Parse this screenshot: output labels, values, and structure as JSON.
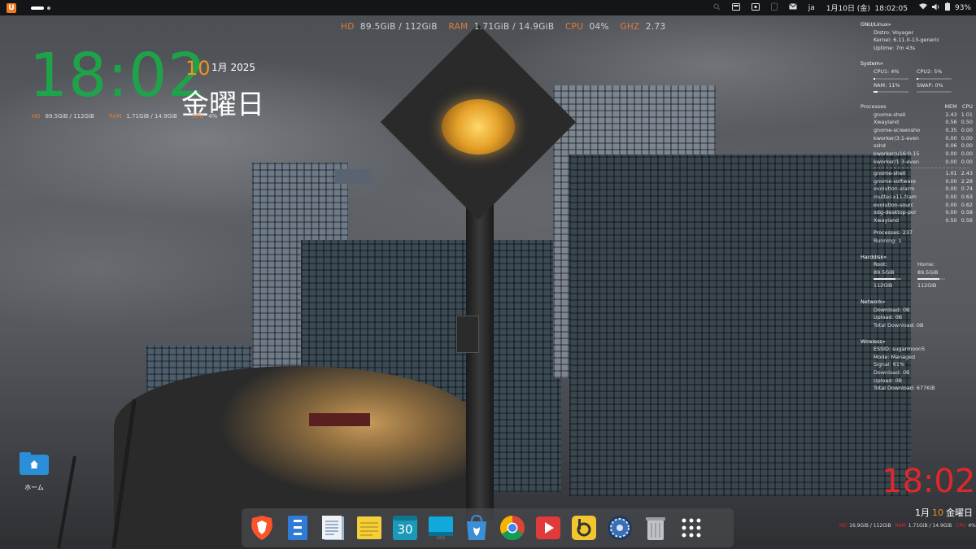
{
  "colors": {
    "clock_green": "#1fa34a",
    "accent_orange": "#e07b39",
    "date_orange": "#f0921e",
    "clock_red": "#e0272c",
    "topbar_bg": "#141518"
  },
  "topbar": {
    "logo_icon": "ubuntu-unity-logo-icon",
    "input_method": "ja",
    "datetime": "1月10日 (金)  18:02:05",
    "battery_percent": "93%",
    "tray_icons": [
      "search-icon",
      "weather-icon",
      "screenshot-icon",
      "clipboard-icon",
      "mail-icon",
      "wifi-icon",
      "volume-icon",
      "battery-icon"
    ]
  },
  "conky_top": {
    "hd_label": "HD",
    "hd_value": "89.5GiB / 112GiB",
    "ram_label": "RAM",
    "ram_value": "1.71GiB / 14.9GiB",
    "cpu_label": "CPU",
    "cpu_value": "04%",
    "ghz_label": "GHZ",
    "ghz_value": "2.73"
  },
  "clock": {
    "time": "18:02",
    "day": "10",
    "month_year": "1月 2025",
    "weekday": "金曜日",
    "stats": {
      "hd_label": "HD",
      "hd_value": "89.5GiB / 112GiB",
      "ram_label": "RAM",
      "ram_value": "1.71GiB / 14.9GiB",
      "cpu_label": "CPU",
      "cpu_value": "4%"
    }
  },
  "panel": {
    "gnu": {
      "title": "GNU/Linux»",
      "distro": "Distro: Voyager",
      "kernel": "Kernel: 6.11.0-13-generic",
      "uptime": "Uptime: 7m 43s"
    },
    "system": {
      "title": "System»",
      "cpu1_label": "CPU1: 4%",
      "cpu1_fill": 0.04,
      "cpu2_label": "CPU2: 5%",
      "cpu2_fill": 0.05,
      "ram_label": "RAM: 11%",
      "ram_fill": 0.11,
      "swap_label": "SWAP: 0%",
      "swap_fill": 0.0
    },
    "processes": {
      "title": "Processes",
      "mem_header": "MEM",
      "cpu_header": "CPU",
      "by_cpu": [
        {
          "name": "gnome-shell",
          "mem": "2.43",
          "cpu": "1.01"
        },
        {
          "name": "Xwayland",
          "mem": "0.56",
          "cpu": "0.50"
        },
        {
          "name": "gnome-screensho",
          "mem": "0.35",
          "cpu": "0.00"
        },
        {
          "name": "kworker/3:1-even",
          "mem": "0.00",
          "cpu": "0.00"
        },
        {
          "name": "sshd",
          "mem": "0.06",
          "cpu": "0.00"
        },
        {
          "name": "kworker/u16:0-15",
          "mem": "0.00",
          "cpu": "0.00"
        },
        {
          "name": "kworker/1:3-even",
          "mem": "0.00",
          "cpu": "0.00"
        }
      ],
      "by_mem": [
        {
          "name": "gnome-shell",
          "mem": "1.01",
          "cpu": "2.43"
        },
        {
          "name": "gnome-software",
          "mem": "0.00",
          "cpu": "2.28"
        },
        {
          "name": "evolution-alarm",
          "mem": "0.00",
          "cpu": "0.74"
        },
        {
          "name": "mutter-x11-fram",
          "mem": "0.00",
          "cpu": "0.63"
        },
        {
          "name": "evolution-sourc",
          "mem": "0.00",
          "cpu": "0.62"
        },
        {
          "name": "xdg-desktop-por",
          "mem": "0.00",
          "cpu": "0.58"
        },
        {
          "name": "Xwayland",
          "mem": "0.50",
          "cpu": "0.56"
        }
      ],
      "total": "Processes: 237",
      "running": "Running: 1"
    },
    "harddisk": {
      "title": "Harddisk»",
      "root_label": "Root: 89.5GiB",
      "root_fill": 0.8,
      "home_label": "Home: 89.5GiB",
      "home_fill": 0.8,
      "root_total": "112GiB",
      "home_total": "112GiB"
    },
    "network": {
      "title": "Network»",
      "download": "Download: 0B",
      "upload": "Upload: 0B",
      "total_download": "Total Download: 0B"
    },
    "wireless": {
      "title": "Wireless»",
      "essid": "ESSID: sugarmoon5",
      "mode": "Mode: Managed",
      "signal": "Signal: 61%",
      "download": "Download: 0B",
      "upload": "Upload: 0B",
      "total_download": "Total Download: 677KiB"
    }
  },
  "right_clock": {
    "time": "18:02",
    "month": "1月",
    "day": "10",
    "weekday": "金曜日",
    "stats": {
      "hd_label": "HD",
      "hd_value": "16.9GiB / 112GiB",
      "ram_label": "RAM",
      "ram_value": "1.71GiB / 14.9GiB",
      "cpu_label": "CPU",
      "cpu_value": "4%"
    }
  },
  "desktop": {
    "home_label": "ホーム"
  },
  "dock": {
    "items": [
      {
        "name": "brave-browser-icon"
      },
      {
        "name": "files-icon"
      },
      {
        "name": "text-editor-icon"
      },
      {
        "name": "notes-icon"
      },
      {
        "name": "calendar-icon",
        "label": "30"
      },
      {
        "name": "display-icon"
      },
      {
        "name": "software-store-icon"
      },
      {
        "name": "chrome-icon"
      },
      {
        "name": "video-player-icon"
      },
      {
        "name": "bitwarden-icon"
      },
      {
        "name": "settings-icon"
      },
      {
        "name": "trash-icon"
      },
      {
        "name": "app-grid-icon"
      }
    ]
  }
}
